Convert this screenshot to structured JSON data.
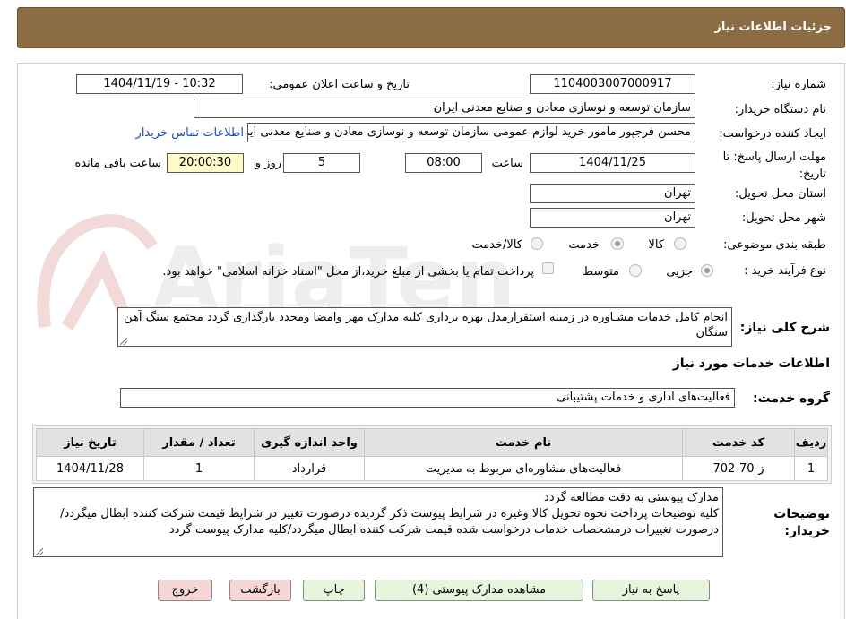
{
  "header": {
    "title": "جزئیات اطلاعات نیاز"
  },
  "watermark": {
    "text": "AriaTender.neT"
  },
  "fields": {
    "need_number": {
      "label": "شماره نیاز:",
      "value": "1104003007000917"
    },
    "announce": {
      "label": "تاریخ و ساعت اعلان عمومی:",
      "value": "1404/11/19 - 10:32"
    },
    "buyer_org": {
      "label": "نام دستگاه خریدار:",
      "value": "سازمان توسعه و نوسازی معادن و صنایع معدنی ایران"
    },
    "requester": {
      "label": "ایجاد کننده درخواست:",
      "value": "محسن فرجپور مامور خرید لوازم عمومی سازمان توسعه و نوسازی معادن و صنایع معدنی ایران",
      "contact_link": "اطلاعات تماس خریدار"
    },
    "deadline": {
      "label": "مهلت ارسال پاسخ: تا تاریخ:",
      "date": "1404/11/25",
      "time_label": "ساعت",
      "time": "08:00",
      "days": "5",
      "days_label": "روز و",
      "remaining": "20:00:30",
      "remaining_label": "ساعت باقی مانده"
    },
    "province": {
      "label": "استان محل تحویل:",
      "value": "تهران"
    },
    "city": {
      "label": "شهر محل تحویل:",
      "value": "تهران"
    },
    "category": {
      "label": "طبقه بندی موضوعی:",
      "options": [
        "کالا",
        "خدمت",
        "کالا/خدمت"
      ],
      "selected": "خدمت"
    },
    "purchase_type": {
      "label": "نوع فرآیند خرید :",
      "options": [
        "جزیی",
        "متوسط"
      ],
      "selected": "جزیی",
      "payment_note": "پرداخت تمام یا بخشی از مبلغ خرید،از محل \"اسناد خزانه اسلامی\" خواهد بود."
    }
  },
  "summary": {
    "label": "شرح کلی نیاز:",
    "text": "انجام کامل خدمات مشـاوره در زمینه استقرارمدل بهره برداری کلیه مدارک مهر وامضا ومجدد بارگذاری گردد مجتمع سنگ آهن سنگان"
  },
  "services": {
    "section_title": "اطلاعات خدمات مورد نیاز",
    "group_label": "گروه خدمت:",
    "group_value": "فعالیت‌های اداری و خدمات پشتیبانی",
    "table": {
      "headers": [
        "ردیف",
        "کد خدمت",
        "نام خدمت",
        "واحد اندازه گیری",
        "تعداد / مقدار",
        "تاریخ نیاز"
      ],
      "rows": [
        [
          "1",
          "ز-70-702",
          "فعالیت‌های مشاوره‌ای مربوط به مدیریت",
          "قرارداد",
          "1",
          "1404/11/28"
        ]
      ]
    }
  },
  "buyer_notes": {
    "label_line1": "توضیحات",
    "label_line2": "خریدار:",
    "line1": "مدارک پیوستی به دقت مطالعه گردد",
    "line2": "کلیه توضیحات پرداخت نحوه تحویل کالا وغیره در شرایط پیوست ذکر گردیده درصورت تغییر در شرایط  قیمت شرکت کننده ابطال میگردد/درصورت تغییرات درمشخصات خدمات درخواست شده قیمت شرکت کننده ابطال میگردد/کلیه مدارک پیوست گردد"
  },
  "buttons": {
    "reply": "پاسخ به نیاز",
    "attachments": "مشاهده مدارک پیوستی (4)",
    "print": "چاپ",
    "back": "بازگشت",
    "exit": "خروج"
  }
}
